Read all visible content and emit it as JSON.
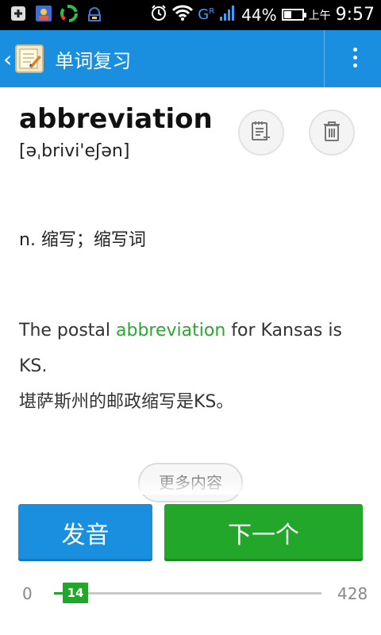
{
  "status_bar": {
    "battery_percent": 44,
    "battery_label": "44%",
    "network_label": "G",
    "network_sub": "R",
    "time_prefix": "上午",
    "time": "9:57",
    "icons": [
      "add-box-icon",
      "contact-card-icon",
      "app-circle-icon",
      "android-download-icon",
      "alarm-clock-icon",
      "wifi-icon",
      "signal-icon",
      "battery-icon"
    ]
  },
  "app_bar": {
    "title": "单词复习"
  },
  "word": {
    "text": "abbreviation",
    "phonetic": "[əˌbrivi'eʃən]",
    "definition": "n. 缩写；缩写词"
  },
  "example": {
    "before": "The postal ",
    "highlight": "abbreviation",
    "after": " for Kansas is KS.",
    "translation": "堪萨斯州的邮政缩写是KS。",
    "highlight_color": "#2aa82f"
  },
  "more_button": "更多内容",
  "actions": {
    "pronounce": "发音",
    "next": "下一个"
  },
  "progress": {
    "min": "0",
    "current": "14",
    "max": "428",
    "current_value": 14,
    "max_value": 428
  },
  "colors": {
    "primary_blue": "#1a8fe0",
    "accent_green": "#22a72a"
  }
}
